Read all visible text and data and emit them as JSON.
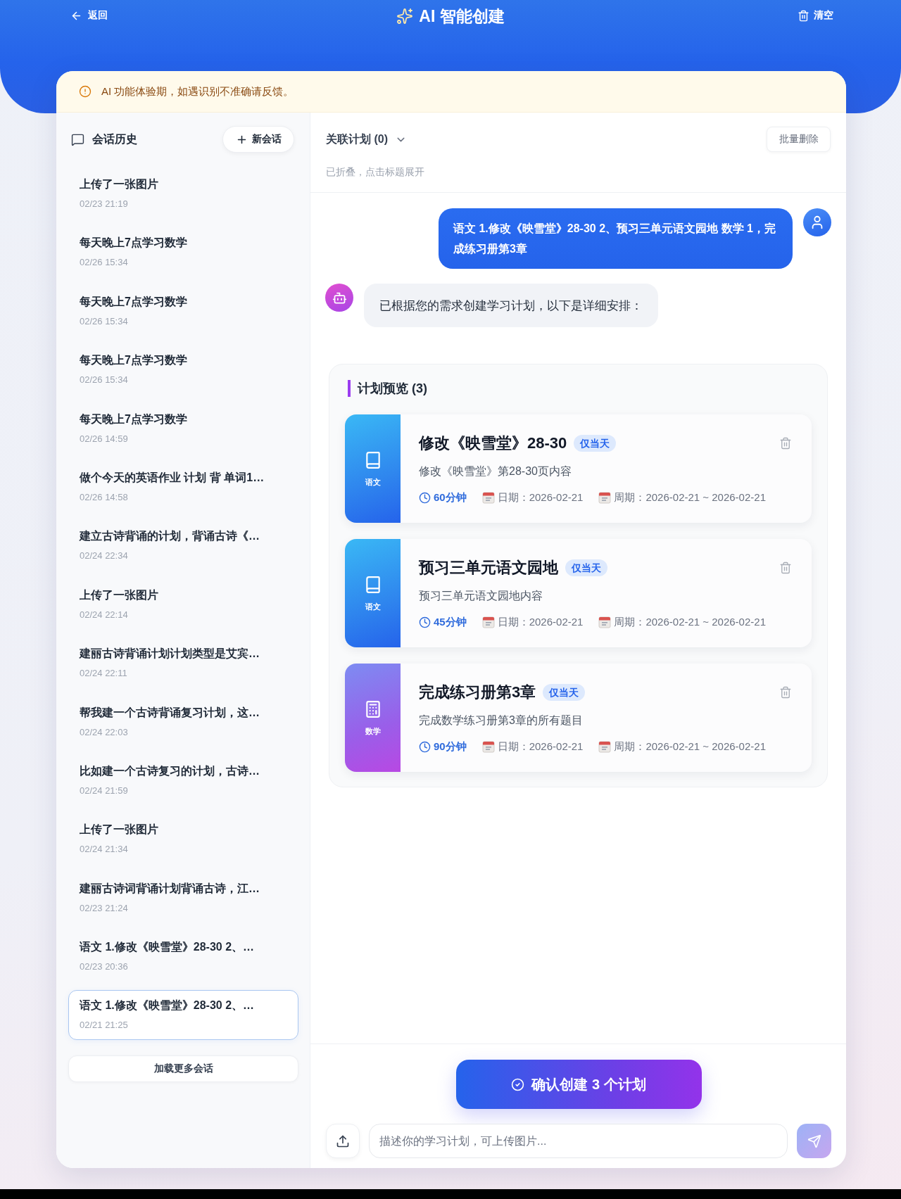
{
  "header": {
    "back": "返回",
    "title": "AI 智能创建",
    "clear": "清空"
  },
  "notice": {
    "text": "AI 功能体验期，如遇识别不准确请反馈。"
  },
  "sidebar": {
    "title": "会话历史",
    "new_button": "新会话",
    "items": [
      {
        "title": "上传了一张图片",
        "time": "02/23 21:19",
        "selected": false
      },
      {
        "title": "每天晚上7点学习数学",
        "time": "02/26 15:34",
        "selected": false
      },
      {
        "title": "每天晚上7点学习数学",
        "time": "02/26 15:34",
        "selected": false
      },
      {
        "title": "每天晚上7点学习数学",
        "time": "02/26 15:34",
        "selected": false
      },
      {
        "title": "每天晚上7点学习数学",
        "time": "02/26 14:59",
        "selected": false
      },
      {
        "title": "做个今天的英语作业 计划 背 单词1…",
        "time": "02/26 14:58",
        "selected": false
      },
      {
        "title": "建立古诗背诵的计划，背诵古诗《…",
        "time": "02/24 22:34",
        "selected": false
      },
      {
        "title": "上传了一张图片",
        "time": "02/24 22:14",
        "selected": false
      },
      {
        "title": "建丽古诗背诵计划计划类型是艾宾…",
        "time": "02/24 22:11",
        "selected": false
      },
      {
        "title": "帮我建一个古诗背诵复习计划，这…",
        "time": "02/24 22:03",
        "selected": false
      },
      {
        "title": "比如建一个古诗复习的计划，古诗…",
        "time": "02/24 21:59",
        "selected": false
      },
      {
        "title": "上传了一张图片",
        "time": "02/24 21:34",
        "selected": false
      },
      {
        "title": "建丽古诗词背诵计划背诵古诗，江…",
        "time": "02/23 21:24",
        "selected": false
      },
      {
        "title": "语文 1.修改《映雪堂》28-30 2、…",
        "time": "02/23 20:36",
        "selected": false
      },
      {
        "title": "语文 1.修改《映雪堂》28-30 2、…",
        "time": "02/21 21:25",
        "selected": true
      }
    ],
    "load_more": "加载更多会话"
  },
  "related_plans": {
    "title": "关联计划 (0)",
    "expanded": false,
    "hint": "已折叠，点击标题展开",
    "batch_delete": "批量删除"
  },
  "messages": [
    {
      "kind": "user",
      "text": "语文 1.修改《映雪堂》28-30 2、预习三单元语文园地 数学 1，完成练习册第3章"
    },
    {
      "kind": "bot",
      "text": "已根据您的需求创建学习计划，以下是详细安排："
    }
  ],
  "plan_preview": {
    "title": "计划预览 (3)",
    "plans": [
      {
        "kind": "book",
        "subject": "语文",
        "title": "修改《映雪堂》28-30",
        "badge": "仅当天",
        "description": "修改《映雪堂》第28-30页内容",
        "duration": "60分钟",
        "date": "日期：2026-02-21",
        "period": "周期：2026-02-21 ~ 2026-02-21"
      },
      {
        "kind": "book",
        "subject": "语文",
        "title": "预习三单元语文园地",
        "badge": "仅当天",
        "description": "预习三单元语文园地内容",
        "duration": "45分钟",
        "date": "日期：2026-02-21",
        "period": "周期：2026-02-21 ~ 2026-02-21"
      },
      {
        "kind": "calculator",
        "subject": "数学",
        "title": "完成练习册第3章",
        "badge": "仅当天",
        "description": "完成数学练习册第3章的所有题目",
        "duration": "90分钟",
        "date": "日期：2026-02-21",
        "period": "周期：2026-02-21 ~ 2026-02-21"
      }
    ]
  },
  "confirm_button": "确认创建 3 个计划",
  "composer": {
    "placeholder": "描述你的学习计划，可上传图片...",
    "send_disabled": true
  }
}
